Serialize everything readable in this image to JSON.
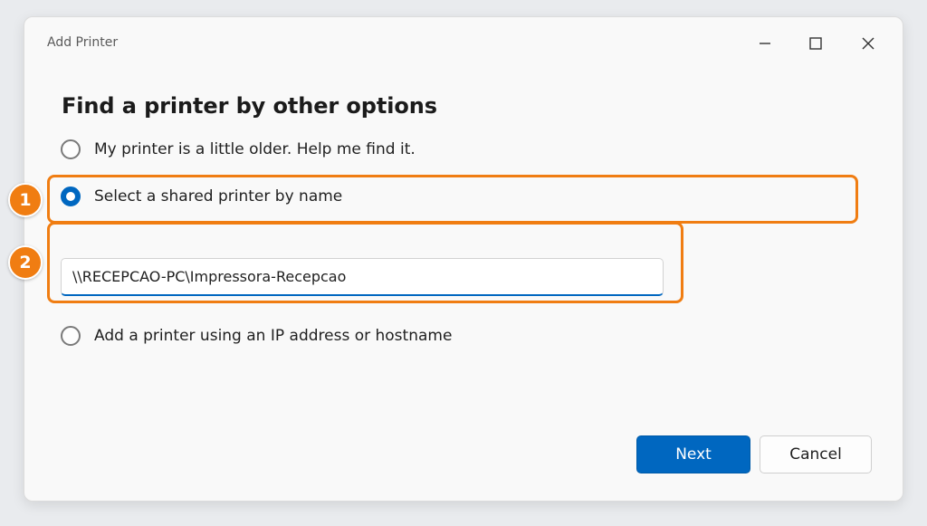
{
  "window": {
    "title": "Add Printer"
  },
  "heading": "Find a printer by other options",
  "options": [
    {
      "label": "My printer is a little older. Help me find it.",
      "checked": false
    },
    {
      "label": "Select a shared printer by name",
      "checked": true
    },
    {
      "label": "Add a printer using an IP address or hostname",
      "checked": false
    }
  ],
  "shared_printer_input": {
    "value": "\\\\RECEPCAO-PC\\Impressora-Recepcao"
  },
  "annotations": {
    "step1": "1",
    "step2": "2"
  },
  "buttons": {
    "next": "Next",
    "cancel": "Cancel"
  },
  "colors": {
    "accent": "#0067c0",
    "highlight": "#f07d12"
  },
  "icons": {
    "minimize": "minimize-icon",
    "maximize": "maximize-icon",
    "close": "close-icon"
  }
}
